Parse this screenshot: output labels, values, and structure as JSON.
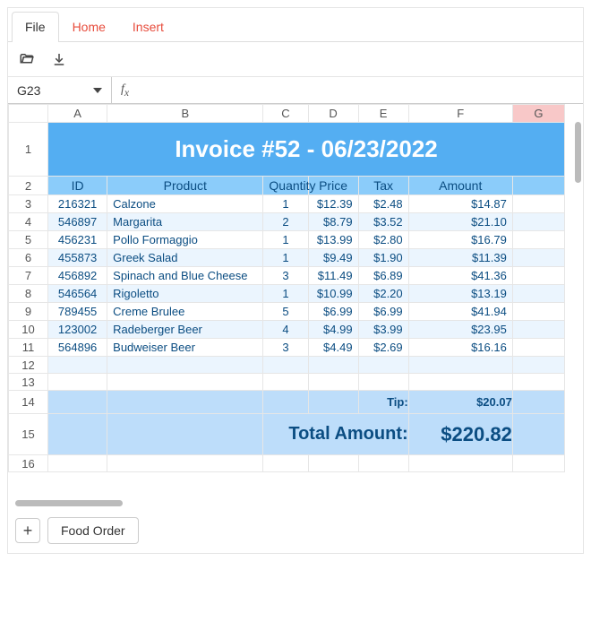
{
  "tabs": {
    "file": "File",
    "home": "Home",
    "insert": "Insert"
  },
  "name_box": "G23",
  "formula_value": "",
  "columns": [
    "A",
    "B",
    "C",
    "D",
    "E",
    "F",
    "G"
  ],
  "selected_col": "G",
  "row_nums": [
    "1",
    "2",
    "3",
    "4",
    "5",
    "6",
    "7",
    "8",
    "9",
    "10",
    "11",
    "12",
    "13",
    "14",
    "15",
    "16"
  ],
  "banner": "Invoice #52 - 06/23/2022",
  "headers": {
    "id": "ID",
    "product": "Product",
    "qty": "Quantity",
    "price": "Price",
    "tax": "Tax",
    "amount": "Amount"
  },
  "rows": [
    {
      "id": "216321",
      "product": "Calzone",
      "qty": "1",
      "price": "$12.39",
      "tax": "$2.48",
      "amount": "$14.87"
    },
    {
      "id": "546897",
      "product": "Margarita",
      "qty": "2",
      "price": "$8.79",
      "tax": "$3.52",
      "amount": "$21.10"
    },
    {
      "id": "456231",
      "product": "Pollo Formaggio",
      "qty": "1",
      "price": "$13.99",
      "tax": "$2.80",
      "amount": "$16.79"
    },
    {
      "id": "455873",
      "product": "Greek Salad",
      "qty": "1",
      "price": "$9.49",
      "tax": "$1.90",
      "amount": "$11.39"
    },
    {
      "id": "456892",
      "product": "Spinach and Blue Cheese",
      "qty": "3",
      "price": "$11.49",
      "tax": "$6.89",
      "amount": "$41.36"
    },
    {
      "id": "546564",
      "product": "Rigoletto",
      "qty": "1",
      "price": "$10.99",
      "tax": "$2.20",
      "amount": "$13.19"
    },
    {
      "id": "789455",
      "product": "Creme Brulee",
      "qty": "5",
      "price": "$6.99",
      "tax": "$6.99",
      "amount": "$41.94"
    },
    {
      "id": "123002",
      "product": "Radeberger Beer",
      "qty": "4",
      "price": "$4.99",
      "tax": "$3.99",
      "amount": "$23.95"
    },
    {
      "id": "564896",
      "product": "Budweiser Beer",
      "qty": "3",
      "price": "$4.49",
      "tax": "$2.69",
      "amount": "$16.16"
    }
  ],
  "tip_label": "Tip:",
  "tip_value": "$20.07",
  "total_label": "Total Amount:",
  "total_value": "$220.82",
  "sheet_tab": "Food Order"
}
